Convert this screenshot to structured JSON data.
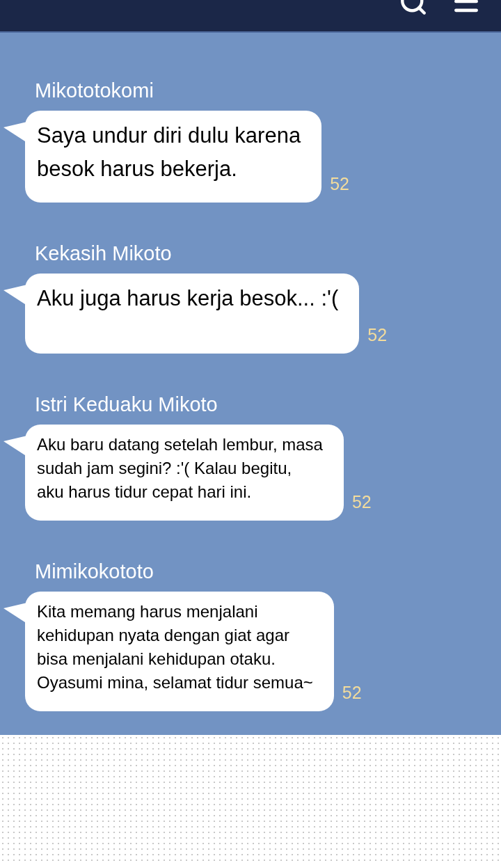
{
  "messages": [
    {
      "sender": "Mikototokomi",
      "text": "Saya undur diri dulu karena\nbesok harus bekerja.",
      "read_count": "52"
    },
    {
      "sender": "Kekasih Mikoto",
      "text": "Aku juga harus kerja besok... :'(",
      "read_count": "52"
    },
    {
      "sender": "Istri Keduaku Mikoto",
      "text": "Aku baru datang setelah lembur, masa\nsudah jam segini? :'( Kalau begitu,\naku harus tidur cepat hari ini.",
      "read_count": "52"
    },
    {
      "sender": "Mimikokototo",
      "text": "Kita memang harus menjalani\nkehidupan nyata dengan giat agar\nbisa menjalani kehidupan otaku.\nOyasumi mina, selamat tidur semua~",
      "read_count": "52"
    }
  ]
}
